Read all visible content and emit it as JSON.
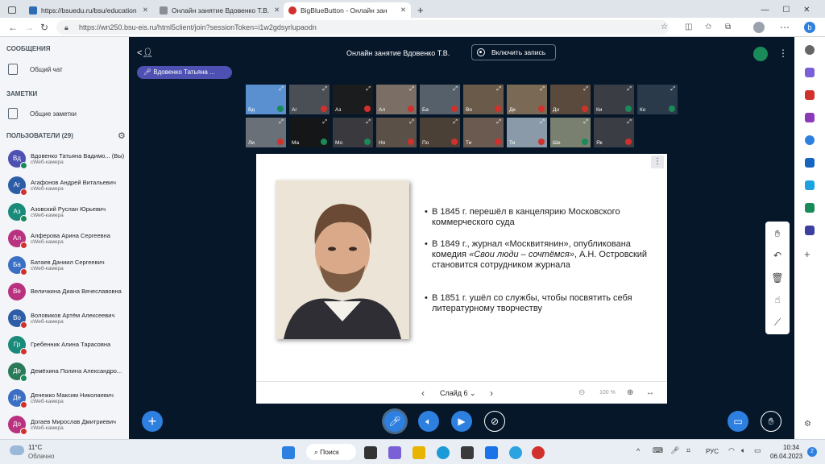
{
  "tabs": [
    {
      "label": "https://bsuedu.ru/bsu/education",
      "color": "#2d6db5"
    },
    {
      "label": "Онлайн занятие Вдовенко Т.В.",
      "color": "#8b8f95"
    },
    {
      "label": "BigBlueButton - Онлайн зан",
      "color": "#d0312d"
    }
  ],
  "url": "https://wn250.bsu-eis.ru/html5client/join?sessionToken=i1w2gdsyrlupaodn",
  "sidebar": {
    "messages_header": "СООБЩЕНИЯ",
    "public_chat": "Общий чат",
    "notes_header": "ЗАМЕТКИ",
    "shared_notes": "Общие заметки",
    "users_header": "ПОЛЬЗОВАТЕЛИ (29)",
    "users": [
      {
        "initials": "Вд",
        "name": "Вдовенко Татьяна Вадимо... (Вы)",
        "status": "сWeб-камера",
        "color": "#4e51b2",
        "badge": "#1a8a5a"
      },
      {
        "initials": "Аг",
        "name": "Агафонов Андрей Витальевич",
        "status": "сWeб-камера",
        "color": "#2e5da8",
        "badge": "#d0312d"
      },
      {
        "initials": "Аз",
        "name": "Азовский Руслан Юрьевич",
        "status": "сWeб-камера",
        "color": "#1a8a7a",
        "badge": "#1a8a5a"
      },
      {
        "initials": "Ал",
        "name": "Алферова Арина Сергеевна",
        "status": "сWeб-камера",
        "color": "#b83280",
        "badge": "#d0312d"
      },
      {
        "initials": "Ба",
        "name": "Батаев Даниил Сергеевич",
        "status": "сWeб-камера",
        "color": "#3a6fc4",
        "badge": "#d0312d"
      },
      {
        "initials": "Ве",
        "name": "Величкина Диана Вячеславовна",
        "status": "",
        "color": "#b83280",
        "badge": ""
      },
      {
        "initials": "Во",
        "name": "Воловиков Артём Алексеевич",
        "status": "сWeб-камера",
        "color": "#2e5da8",
        "badge": "#d0312d"
      },
      {
        "initials": "Гр",
        "name": "Гребенник Алина Тарасовна",
        "status": "",
        "color": "#1a8a7a",
        "badge": "#d0312d"
      },
      {
        "initials": "Де",
        "name": "Демёхина Полина Александро...",
        "status": "",
        "color": "#2a7a5a",
        "badge": "#1a8a5a"
      },
      {
        "initials": "Де",
        "name": "Денежко Максим Николаевич",
        "status": "сWeб-камера",
        "color": "#3a6fc4",
        "badge": "#d0312d"
      },
      {
        "initials": "До",
        "name": "Догаев Мирослав Дмитриевич",
        "status": "сWeб-камера",
        "color": "#b83280",
        "badge": "#d0312d"
      }
    ]
  },
  "meeting": {
    "title": "Онлайн занятие Вдовенко Т.В.",
    "record_label": "Включить запись",
    "speaker": "Вдовенко Татьяна ..."
  },
  "video_tiles": [
    {
      "name": "Вд",
      "mic": "#1a8a5a",
      "bg": "#5a8fd0"
    },
    {
      "name": "Аг",
      "mic": "#d0312d",
      "bg": "#4a4e55"
    },
    {
      "name": "Аз",
      "mic": "#d0312d",
      "bg": "#1a1c1e"
    },
    {
      "name": "Ал",
      "mic": "#d0312d",
      "bg": "#7a6e65"
    },
    {
      "name": "Ба",
      "mic": "#d0312d",
      "bg": "#55606a"
    },
    {
      "name": "Во",
      "mic": "#d0312d",
      "bg": "#6a5a4a"
    },
    {
      "name": "Де",
      "mic": "#d0312d",
      "bg": "#7a6a55"
    },
    {
      "name": "До",
      "mic": "#d0312d",
      "bg": "#5a4a3e"
    },
    {
      "name": "Ки",
      "mic": "#1a8a5a",
      "bg": "#3a3e44"
    },
    {
      "name": "Ко",
      "mic": "#1a8a5a",
      "bg": "#2a3a4a"
    },
    {
      "name": "Ли",
      "mic": "#d0312d",
      "bg": "#6a7078"
    },
    {
      "name": "Ма",
      "mic": "#1a8a5a",
      "bg": "#141618"
    },
    {
      "name": "Мо",
      "mic": "#1a8a5a",
      "bg": "#3a3a3e"
    },
    {
      "name": "Но",
      "mic": "#d0312d",
      "bg": "#5a5048"
    },
    {
      "name": "По",
      "mic": "#d0312d",
      "bg": "#4a4035"
    },
    {
      "name": "Ти",
      "mic": "#d0312d",
      "bg": "#6a5a50"
    },
    {
      "name": "Ти",
      "mic": "#d0312d",
      "bg": "#8a9aa8"
    },
    {
      "name": "Ше",
      "mic": "#1a8a5a",
      "bg": "#7a8070"
    },
    {
      "name": "Як",
      "mic": "#d0312d",
      "bg": "#3a3e44"
    }
  ],
  "slide": {
    "bullets": [
      {
        "text": "В 1845 г. перешёл в канцелярию Московского коммерческого суда"
      },
      {
        "pre": "В 1849 г., журнал «Москвитянин», опубликована комедия ",
        "italic": "«Свои люди – сочтёмся»",
        "post": ", А.Н. Островский становится сотрудником журнала"
      },
      {
        "text": "В 1851 г. ушёл со службы, чтобы посвятить себя литературному творчеству"
      }
    ],
    "nav_label": "Слайд 6",
    "zoom": "100 %"
  },
  "taskbar": {
    "weather_temp": "11°C",
    "weather_desc": "Облачно",
    "search": "Поиск",
    "lang": "РУС",
    "time": "10:34",
    "date": "06.04.2023",
    "notif": "2"
  }
}
